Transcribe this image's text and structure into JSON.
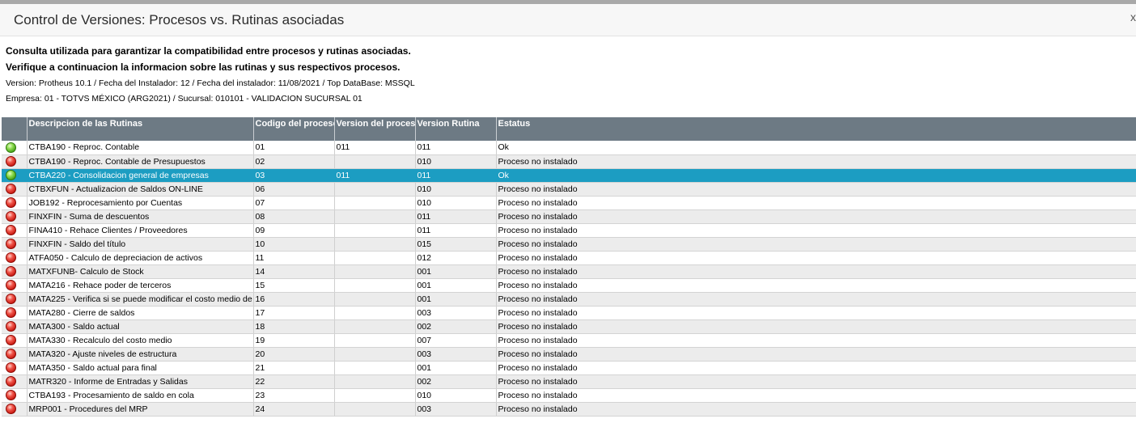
{
  "window": {
    "title": "Control de Versiones: Procesos vs. Rutinas asociadas",
    "close_label": "x"
  },
  "info": {
    "line1": "Consulta utilizada para garantizar la compatibilidad entre procesos y rutinas asociadas.",
    "line2": "Verifique a continuacion la informacion sobre las rutinas y sus respectivos procesos.",
    "line3": "Version: Protheus 10.1 / Fecha del Instalador: 12 / Fecha del instalador: 11/08/2021 / Top DataBase: MSSQL",
    "line4": "Empresa: 01 - TOTVS MÉXICO (ARG2021) / Sucursal: 010101 - VALIDACION SUCURSAL 01"
  },
  "grid": {
    "columns": [
      "",
      "Descripcion de las Rutinas",
      "Codigo del proceso",
      "Version del proceso",
      "Version Rutina",
      "Estatus"
    ],
    "selected_row": 2,
    "rows": [
      {
        "icon": "green-status-icon",
        "descripcion": "CTBA190 - Reproc. Contable",
        "codigo": "01",
        "version_proceso": "011",
        "version_rutina": "011",
        "estatus": "Ok"
      },
      {
        "icon": "red-status-icon",
        "descripcion": "CTBA190 - Reproc. Contable de Presupuestos",
        "codigo": "02",
        "version_proceso": "",
        "version_rutina": "010",
        "estatus": "Proceso no instalado"
      },
      {
        "icon": "green-status-icon",
        "descripcion": "CTBA220 - Consolidacion general de empresas",
        "codigo": "03",
        "version_proceso": "011",
        "version_rutina": "011",
        "estatus": "Ok"
      },
      {
        "icon": "red-status-icon",
        "descripcion": "CTBXFUN - Actualizacion de Saldos ON-LINE",
        "codigo": "06",
        "version_proceso": "",
        "version_rutina": "010",
        "estatus": "Proceso no instalado"
      },
      {
        "icon": "red-status-icon",
        "descripcion": "JOB192 - Reprocesamiento por Cuentas",
        "codigo": "07",
        "version_proceso": "",
        "version_rutina": "010",
        "estatus": "Proceso no instalado"
      },
      {
        "icon": "red-status-icon",
        "descripcion": "FINXFIN - Suma de descuentos",
        "codigo": "08",
        "version_proceso": "",
        "version_rutina": "011",
        "estatus": "Proceso no instalado"
      },
      {
        "icon": "red-status-icon",
        "descripcion": "FINA410 - Rehace Clientes / Proveedores",
        "codigo": "09",
        "version_proceso": "",
        "version_rutina": "011",
        "estatus": "Proceso no instalado"
      },
      {
        "icon": "red-status-icon",
        "descripcion": "FINXFIN - Saldo del título",
        "codigo": "10",
        "version_proceso": "",
        "version_rutina": "015",
        "estatus": "Proceso no instalado"
      },
      {
        "icon": "red-status-icon",
        "descripcion": "ATFA050 - Calculo de depreciacion de activos",
        "codigo": "11",
        "version_proceso": "",
        "version_rutina": "012",
        "estatus": "Proceso no instalado"
      },
      {
        "icon": "red-status-icon",
        "descripcion": "MATXFUNB- Calculo de Stock",
        "codigo": "14",
        "version_proceso": "",
        "version_rutina": "001",
        "estatus": "Proceso no instalado"
      },
      {
        "icon": "red-status-icon",
        "descripcion": "MATA216 - Rehace poder de terceros",
        "codigo": "15",
        "version_proceso": "",
        "version_rutina": "001",
        "estatus": "Proceso no instalado"
      },
      {
        "icon": "red-status-icon",
        "descripcion": "MATA225 - Verifica si se puede modificar el costo medio de",
        "codigo": "16",
        "version_proceso": "",
        "version_rutina": "001",
        "estatus": "Proceso no instalado"
      },
      {
        "icon": "red-status-icon",
        "descripcion": "MATA280 - Cierre de saldos",
        "codigo": "17",
        "version_proceso": "",
        "version_rutina": "003",
        "estatus": "Proceso no instalado"
      },
      {
        "icon": "red-status-icon",
        "descripcion": "MATA300 - Saldo actual",
        "codigo": "18",
        "version_proceso": "",
        "version_rutina": "002",
        "estatus": "Proceso no instalado"
      },
      {
        "icon": "red-status-icon",
        "descripcion": "MATA330 - Recalculo del costo medio",
        "codigo": "19",
        "version_proceso": "",
        "version_rutina": "007",
        "estatus": "Proceso no instalado"
      },
      {
        "icon": "red-status-icon",
        "descripcion": "MATA320 - Ajuste niveles de estructura",
        "codigo": "20",
        "version_proceso": "",
        "version_rutina": "003",
        "estatus": "Proceso no instalado"
      },
      {
        "icon": "red-status-icon",
        "descripcion": "MATA350 - Saldo actual para final",
        "codigo": "21",
        "version_proceso": "",
        "version_rutina": "001",
        "estatus": "Proceso no instalado"
      },
      {
        "icon": "red-status-icon",
        "descripcion": "MATR320 - Informe de Entradas y Salidas",
        "codigo": "22",
        "version_proceso": "",
        "version_rutina": "002",
        "estatus": "Proceso no instalado"
      },
      {
        "icon": "red-status-icon",
        "descripcion": "CTBA193 - Procesamiento de saldo en cola",
        "codigo": "23",
        "version_proceso": "",
        "version_rutina": "010",
        "estatus": "Proceso no instalado"
      },
      {
        "icon": "red-status-icon",
        "descripcion": "MRP001 - Procedures del MRP",
        "codigo": "24",
        "version_proceso": "",
        "version_rutina": "003",
        "estatus": "Proceso no instalado"
      }
    ]
  },
  "colors": {
    "header_bg": "#6d7a84",
    "selected_row_bg": "#1c9dc2",
    "ok_status": "#4caf1a",
    "error_status": "#d32018"
  }
}
